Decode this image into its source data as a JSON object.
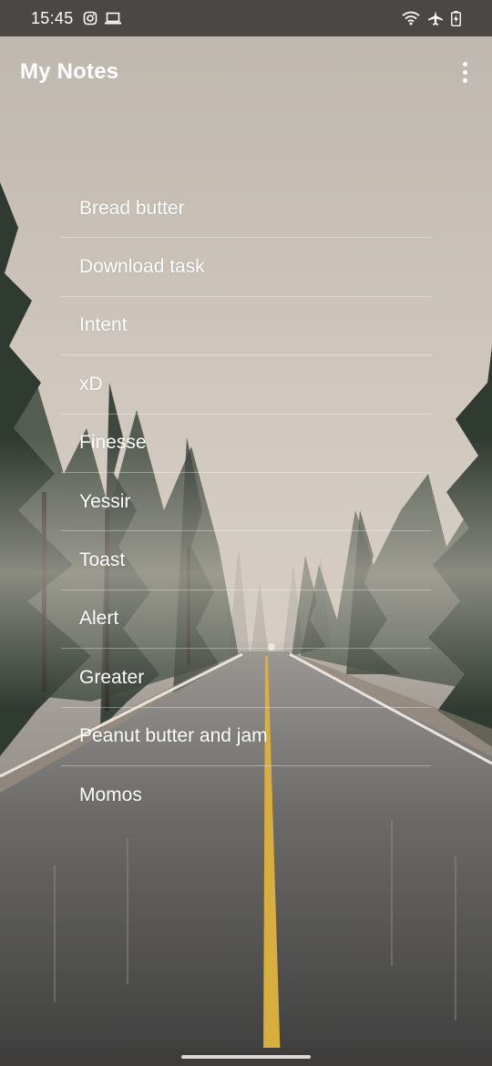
{
  "status_bar": {
    "time": "15:45",
    "left_icons": [
      "instagram-icon",
      "laptop-icon"
    ],
    "right_icons": [
      "wifi-icon",
      "airplane-icon",
      "battery-charging-icon"
    ]
  },
  "app_bar": {
    "title": "My Notes",
    "menu_icon": "more-vert-icon"
  },
  "notes": [
    {
      "label": "Bread butter"
    },
    {
      "label": "Download task"
    },
    {
      "label": "Intent"
    },
    {
      "label": "xD"
    },
    {
      "label": "Finesse"
    },
    {
      "label": "Yessir"
    },
    {
      "label": "Toast"
    },
    {
      "label": "Alert"
    },
    {
      "label": "Greater"
    },
    {
      "label": "Peanut butter and jam"
    },
    {
      "label": "Momos"
    }
  ],
  "colors": {
    "status_bar_bg": "#4b4744",
    "text": "#ffffff",
    "fog": "#c8c0b7",
    "road_line": "#e0b642"
  }
}
